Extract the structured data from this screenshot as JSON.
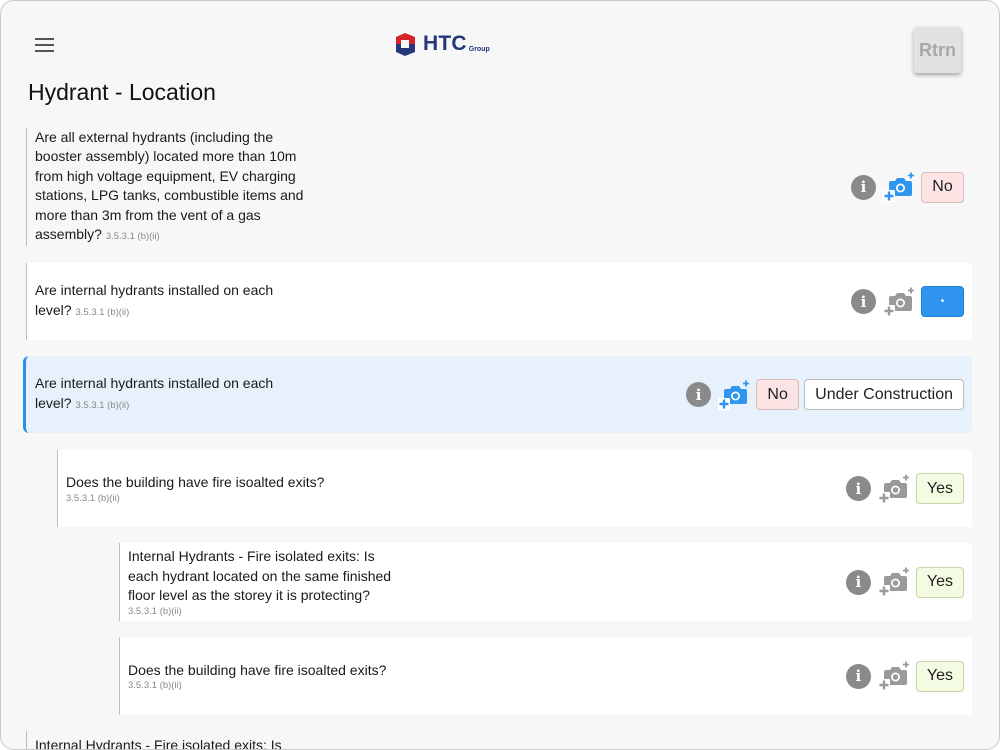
{
  "header": {
    "logo_text": "HTC",
    "logo_sub": "Group",
    "return_label": "Rtrn"
  },
  "page": {
    "title": "Hydrant - Location"
  },
  "questions": [
    {
      "text": "Are all external hydrants (including the booster assembly) located more than 10m from high voltage equipment, EV charging stations, LPG tanks, combustible items and more than 3m from the vent of a gas assembly?",
      "ref": "3.5.3.1 (b)(ii)",
      "answers": [
        "No"
      ],
      "camera_active": true
    },
    {
      "text": "Are internal hydrants installed on each level?",
      "ref": "3.5.3.1 (b)(ii)",
      "answers": [
        "•"
      ],
      "camera_active": false
    },
    {
      "text": "Are internal hydrants installed on each level?",
      "ref": "3.5.3.1 (b)(ii)",
      "answers": [
        "No",
        "Under Construction"
      ],
      "camera_active": true,
      "selected": true
    },
    {
      "text": "Does the building have fire isoalted exits?",
      "ref": "3.5.3.1 (b)(ii)",
      "answers": [
        "Yes"
      ],
      "camera_active": false
    },
    {
      "text": "Internal Hydrants - Fire isolated exits: Is each hydrant located on the same finished floor level as the storey it is protecting?",
      "ref": "3.5.3.1 (b)(ii)",
      "answers": [
        "Yes"
      ],
      "camera_active": false
    },
    {
      "text": "Does the building have fire isoalted exits?",
      "ref": "3.5.3.1 (b)(ii)",
      "answers": [
        "Yes"
      ],
      "camera_active": false
    },
    {
      "text": "Internal Hydrants - Fire isolated exits: Is",
      "ref": "",
      "answers": [],
      "camera_active": false
    }
  ],
  "icons": {
    "menu": "hamburger-icon",
    "info": "info-icon",
    "camera": "add-photo-icon"
  },
  "colors": {
    "accent_blue": "#2f95ee",
    "no_bg": "#fce4e4",
    "yes_bg": "#f4fbe3",
    "selected_bg": "#e7f1fb",
    "logo_navy": "#23377a",
    "logo_red": "#d8232a"
  }
}
